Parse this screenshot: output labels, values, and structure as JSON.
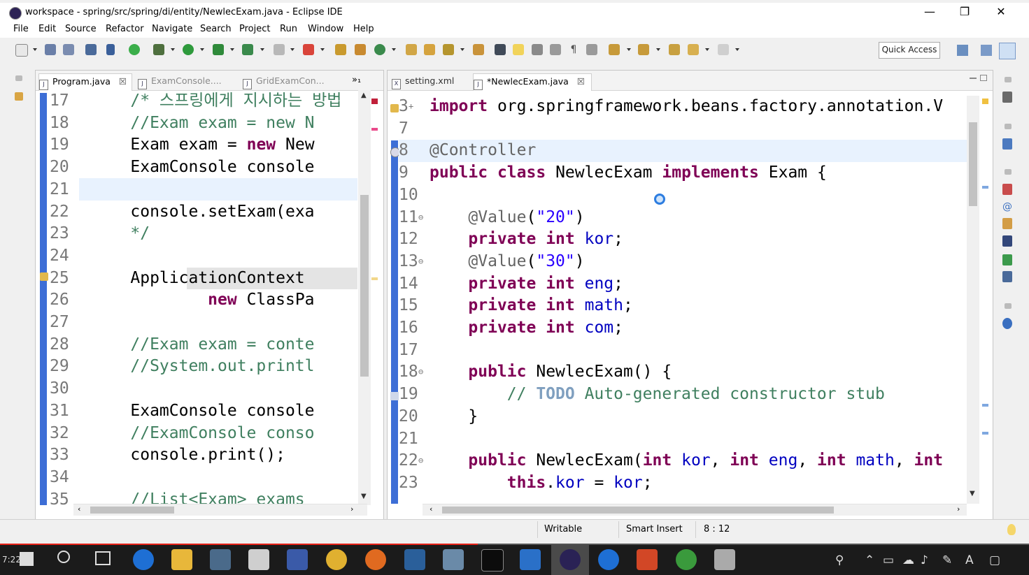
{
  "window": {
    "title": "workspace - spring/src/spring/di/entity/NewlecExam.java - Eclipse IDE",
    "minimize": "—",
    "maximize": "❐",
    "close": "✕"
  },
  "menu": [
    "File",
    "Edit",
    "Source",
    "Refactor",
    "Navigate",
    "Search",
    "Project",
    "Run",
    "Window",
    "Help"
  ],
  "toolbar": {
    "quick_access": "Quick Access"
  },
  "left_editor": {
    "tabs": [
      {
        "label": "Program.java",
        "close": "☒"
      },
      {
        "label": "ExamConsole...."
      },
      {
        "label": "GridExamCon..."
      }
    ],
    "overflow": "»₁",
    "lines": [
      {
        "n": "17",
        "code": "    /* 스프링에게 지시하는 방법"
      },
      {
        "n": "18",
        "code": "    //Exam exam = new N"
      },
      {
        "n": "19",
        "code": "    Exam exam = new New"
      },
      {
        "n": "20",
        "code": "    ExamConsole console"
      },
      {
        "n": "21",
        "code": ""
      },
      {
        "n": "22",
        "code": "    console.setExam(exa"
      },
      {
        "n": "23",
        "code": "    */"
      },
      {
        "n": "24",
        "code": ""
      },
      {
        "n": "25",
        "code": "    ApplicationContext"
      },
      {
        "n": "26",
        "code": "            new ClassPa"
      },
      {
        "n": "27",
        "code": ""
      },
      {
        "n": "28",
        "code": "    //Exam exam = conte"
      },
      {
        "n": "29",
        "code": "    //System.out.printl"
      },
      {
        "n": "30",
        "code": ""
      },
      {
        "n": "31",
        "code": "    ExamConsole console"
      },
      {
        "n": "32",
        "code": "    //ExamConsole conso"
      },
      {
        "n": "33",
        "code": "    console.print();"
      },
      {
        "n": "34",
        "code": ""
      },
      {
        "n": "35",
        "code": "    //List<Exam> exams"
      }
    ]
  },
  "right_editor": {
    "tabs": [
      {
        "label": "setting.xml"
      },
      {
        "label": "*NewlecExam.java",
        "close": "☒"
      }
    ],
    "lines": [
      {
        "n": "3",
        "fold": "+",
        "code": "import org.springframework.beans.factory.annotation.V"
      },
      {
        "n": "7",
        "code": ""
      },
      {
        "n": "8",
        "code": "@Controller"
      },
      {
        "n": "9",
        "code": "public class NewlecExam implements Exam {"
      },
      {
        "n": "10",
        "code": ""
      },
      {
        "n": "11",
        "fold": "⊖",
        "code": "    @Value(\"20\")"
      },
      {
        "n": "12",
        "code": "    private int kor;"
      },
      {
        "n": "13",
        "fold": "⊖",
        "code": "    @Value(\"30\")"
      },
      {
        "n": "14",
        "code": "    private int eng;"
      },
      {
        "n": "15",
        "code": "    private int math;"
      },
      {
        "n": "16",
        "code": "    private int com;"
      },
      {
        "n": "17",
        "code": ""
      },
      {
        "n": "18",
        "fold": "⊖",
        "code": "    public NewlecExam() {"
      },
      {
        "n": "19",
        "code": "        // TODO Auto-generated constructor stub"
      },
      {
        "n": "20",
        "code": "    }"
      },
      {
        "n": "21",
        "code": ""
      },
      {
        "n": "22",
        "fold": "⊖",
        "code": "    public NewlecExam(int kor, int eng, int math, int"
      },
      {
        "n": "23",
        "code": "        this.kor = kor;"
      }
    ]
  },
  "status": {
    "mode": "Writable",
    "insert": "Smart Insert",
    "position": "8 : 12"
  },
  "taskbar": {
    "time": "7:22",
    "tray_a": "A"
  },
  "colors": {
    "keyword": "#7f0055",
    "comment": "#3f7f5f",
    "string": "#2a00ff",
    "field": "#0000c0",
    "annotation": "#646464",
    "progress": "#e62117"
  }
}
